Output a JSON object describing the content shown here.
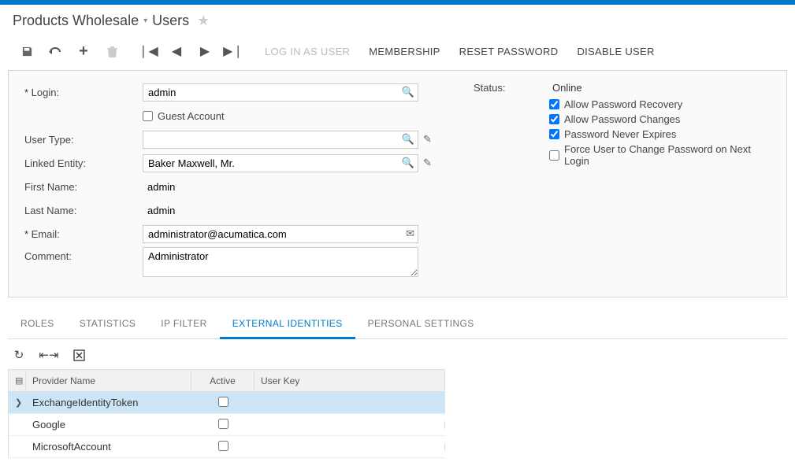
{
  "breadcrumb": {
    "parent": "Products Wholesale",
    "current": "Users"
  },
  "toolbar": {
    "login_as_user": "LOG IN AS USER",
    "membership": "MEMBERSHIP",
    "reset_password": "RESET PASSWORD",
    "disable_user": "DISABLE USER"
  },
  "form": {
    "labels": {
      "login": "Login:",
      "guest": "Guest Account",
      "user_type": "User Type:",
      "linked_entity": "Linked Entity:",
      "first_name": "First Name:",
      "last_name": "Last Name:",
      "email": "Email:",
      "comment": "Comment:",
      "status": "Status:"
    },
    "values": {
      "login": "admin",
      "user_type": "",
      "linked_entity": "Baker Maxwell, Mr.",
      "first_name": "admin",
      "last_name": "admin",
      "email": "administrator@acumatica.com",
      "comment": "Administrator",
      "status": "Online"
    },
    "options": {
      "allow_recovery": "Allow Password Recovery",
      "allow_changes": "Allow Password Changes",
      "never_expires": "Password Never Expires",
      "force_change": "Force User to Change Password on Next Login"
    },
    "checks": {
      "guest": false,
      "allow_recovery": true,
      "allow_changes": true,
      "never_expires": true,
      "force_change": false
    }
  },
  "tabs": {
    "roles": "ROLES",
    "statistics": "STATISTICS",
    "ip_filter": "IP FILTER",
    "external": "EXTERNAL IDENTITIES",
    "personal": "PERSONAL SETTINGS"
  },
  "grid": {
    "headers": {
      "provider": "Provider Name",
      "active": "Active",
      "user_key": "User Key"
    },
    "rows": [
      {
        "provider": "ExchangeIdentityToken",
        "active": false,
        "user_key": "",
        "selected": true
      },
      {
        "provider": "Google",
        "active": false,
        "user_key": "",
        "selected": false
      },
      {
        "provider": "MicrosoftAccount",
        "active": false,
        "user_key": "",
        "selected": false
      }
    ]
  }
}
